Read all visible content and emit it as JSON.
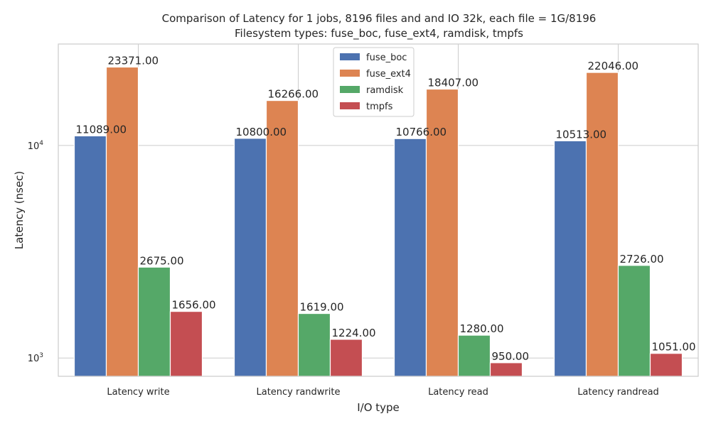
{
  "chart_data": {
    "type": "bar",
    "title": "Comparison of Latency for 1 jobs, 8196 files and  and IO 32k, each file = 1G/8196",
    "subtitle": "Filesystem types: fuse_boc, fuse_ext4, ramdisk, tmpfs",
    "xlabel": "I/O type",
    "ylabel": "Latency (nsec)",
    "yscale": "log",
    "ylim": [
      820,
      30000
    ],
    "yticks": [
      {
        "value": 1000,
        "base": "10",
        "exp": "3"
      },
      {
        "value": 10000,
        "base": "10",
        "exp": "4"
      }
    ],
    "categories": [
      "Latency write",
      "Latency randwrite",
      "Latency read",
      "Latency randread"
    ],
    "series": [
      {
        "name": "fuse_boc",
        "color": "#4c72b0",
        "values": [
          11089,
          10800,
          10766,
          10513
        ],
        "labels": [
          "11089.00",
          "10800.00",
          "10766.00",
          "10513.00"
        ]
      },
      {
        "name": "fuse_ext4",
        "color": "#dd8452",
        "values": [
          23371,
          16266,
          18407,
          22046
        ],
        "labels": [
          "23371.00",
          "16266.00",
          "18407.00",
          "22046.00"
        ]
      },
      {
        "name": "ramdisk",
        "color": "#55a868",
        "values": [
          2675,
          1619,
          1280,
          2726
        ],
        "labels": [
          "2675.00",
          "1619.00",
          "1280.00",
          "2726.00"
        ]
      },
      {
        "name": "tmpfs",
        "color": "#c44e52",
        "values": [
          1656,
          1224,
          950,
          1051
        ],
        "labels": [
          "1656.00",
          "1224.00",
          "950.00",
          "1051.00"
        ]
      }
    ],
    "grid": true,
    "legend": "top-center"
  }
}
